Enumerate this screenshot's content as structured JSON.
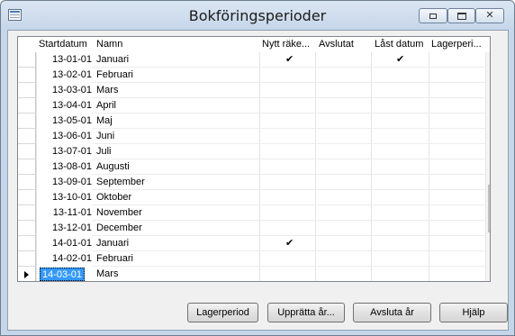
{
  "window": {
    "title": "Bokföringsperioder",
    "controls": {
      "minimize": "minimize-icon",
      "maximize": "maximize-icon",
      "close": "close-icon"
    }
  },
  "grid": {
    "columns": [
      "Startdatum",
      "Namn",
      "Nytt räke...",
      "Avslutat",
      "Låst datum",
      "Lagerperi..."
    ],
    "rows": [
      {
        "date": "13-01-01",
        "name": "Januari",
        "new_fiscal_year": true,
        "closed": false,
        "date_locked": true
      },
      {
        "date": "13-02-01",
        "name": "Februari",
        "new_fiscal_year": false,
        "closed": false,
        "date_locked": false
      },
      {
        "date": "13-03-01",
        "name": "Mars",
        "new_fiscal_year": false,
        "closed": false,
        "date_locked": false
      },
      {
        "date": "13-04-01",
        "name": "April",
        "new_fiscal_year": false,
        "closed": false,
        "date_locked": false
      },
      {
        "date": "13-05-01",
        "name": "Maj",
        "new_fiscal_year": false,
        "closed": false,
        "date_locked": false
      },
      {
        "date": "13-06-01",
        "name": "Juni",
        "new_fiscal_year": false,
        "closed": false,
        "date_locked": false
      },
      {
        "date": "13-07-01",
        "name": "Juli",
        "new_fiscal_year": false,
        "closed": false,
        "date_locked": false
      },
      {
        "date": "13-08-01",
        "name": "Augusti",
        "new_fiscal_year": false,
        "closed": false,
        "date_locked": false
      },
      {
        "date": "13-09-01",
        "name": "September",
        "new_fiscal_year": false,
        "closed": false,
        "date_locked": false
      },
      {
        "date": "13-10-01",
        "name": "Oktober",
        "new_fiscal_year": false,
        "closed": false,
        "date_locked": false
      },
      {
        "date": "13-11-01",
        "name": "November",
        "new_fiscal_year": false,
        "closed": false,
        "date_locked": false
      },
      {
        "date": "13-12-01",
        "name": "December",
        "new_fiscal_year": false,
        "closed": false,
        "date_locked": false
      },
      {
        "date": "14-01-01",
        "name": "Januari",
        "new_fiscal_year": true,
        "closed": false,
        "date_locked": false
      },
      {
        "date": "14-02-01",
        "name": "Februari",
        "new_fiscal_year": false,
        "closed": false,
        "date_locked": false
      },
      {
        "date": "14-03-01",
        "name": "Mars",
        "new_fiscal_year": false,
        "closed": false,
        "date_locked": false,
        "current": true
      }
    ],
    "check_glyph": "✔",
    "scroll": {
      "up_icon": "▲",
      "down_icon": "▼"
    }
  },
  "buttons": {
    "inventory_period": "Lagerperiod",
    "create_year": "Upprätta år...",
    "close_year": "Avsluta år",
    "help": "Hjälp"
  }
}
